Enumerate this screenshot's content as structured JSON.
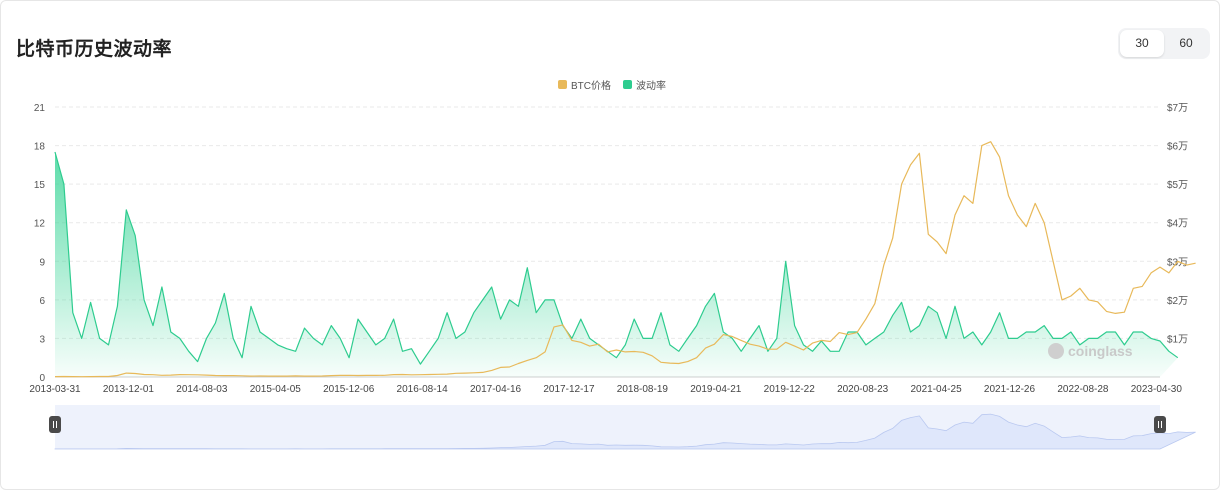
{
  "page": {
    "title": "比特币历史波动率",
    "toggle": {
      "options": [
        "30",
        "60"
      ],
      "selected": "30"
    },
    "watermark": "coinglass"
  },
  "colors": {
    "btc": "#e8b95a",
    "vol": "#2ecc8f",
    "vol_fill_top": "#3fd69a",
    "grid": "#e9e9e9",
    "navigator_fill": "#dfe7fb",
    "navigator_line": "#b9c8f0"
  },
  "chart_data": {
    "type": "line",
    "title": "",
    "legend": [
      "BTC价格",
      "波动率"
    ],
    "legend_position": "top-center",
    "x_tick_labels": [
      "2013-03-31",
      "2013-12-01",
      "2014-08-03",
      "2015-04-05",
      "2015-12-06",
      "2016-08-14",
      "2017-04-16",
      "2017-12-17",
      "2018-08-19",
      "2019-04-21",
      "2019-12-22",
      "2020-08-23",
      "2021-04-25",
      "2021-12-26",
      "2022-08-28",
      "2023-04-30"
    ],
    "y_left": {
      "ticks": [
        "0",
        "3",
        "6",
        "9",
        "12",
        "15",
        "18",
        "21"
      ],
      "range": [
        0,
        21
      ]
    },
    "y_right": {
      "ticks": [
        "$1万",
        "$2万",
        "$3万",
        "$4万",
        "$5万",
        "$6万",
        "$7万"
      ],
      "range": [
        0,
        70000
      ]
    },
    "x": [
      "2013-03-31",
      "2013-05-01",
      "2013-06-01",
      "2013-07-01",
      "2013-08-01",
      "2013-09-01",
      "2013-10-01",
      "2013-11-01",
      "2013-12-01",
      "2014-01-01",
      "2014-02-01",
      "2014-03-01",
      "2014-04-01",
      "2014-05-01",
      "2014-06-01",
      "2014-07-01",
      "2014-08-01",
      "2014-09-01",
      "2014-10-01",
      "2014-11-01",
      "2014-12-01",
      "2015-01-01",
      "2015-02-01",
      "2015-03-01",
      "2015-04-01",
      "2015-05-01",
      "2015-06-01",
      "2015-07-01",
      "2015-08-01",
      "2015-09-01",
      "2015-10-01",
      "2015-11-01",
      "2015-12-01",
      "2016-01-01",
      "2016-02-01",
      "2016-03-01",
      "2016-04-01",
      "2016-05-01",
      "2016-06-01",
      "2016-07-01",
      "2016-08-01",
      "2016-09-01",
      "2016-10-01",
      "2016-11-01",
      "2016-12-01",
      "2017-01-01",
      "2017-02-01",
      "2017-03-01",
      "2017-04-01",
      "2017-05-01",
      "2017-06-01",
      "2017-07-01",
      "2017-08-01",
      "2017-09-01",
      "2017-10-01",
      "2017-11-01",
      "2017-12-01",
      "2018-01-01",
      "2018-02-01",
      "2018-03-01",
      "2018-04-01",
      "2018-05-01",
      "2018-06-01",
      "2018-07-01",
      "2018-08-01",
      "2018-09-01",
      "2018-10-01",
      "2018-11-01",
      "2018-12-01",
      "2019-01-01",
      "2019-02-01",
      "2019-03-01",
      "2019-04-01",
      "2019-05-01",
      "2019-06-01",
      "2019-07-01",
      "2019-08-01",
      "2019-09-01",
      "2019-10-01",
      "2019-11-01",
      "2019-12-01",
      "2020-01-01",
      "2020-02-01",
      "2020-03-01",
      "2020-04-01",
      "2020-05-01",
      "2020-06-01",
      "2020-07-01",
      "2020-08-01",
      "2020-09-01",
      "2020-10-01",
      "2020-11-01",
      "2020-12-01",
      "2021-01-01",
      "2021-02-01",
      "2021-03-01",
      "2021-04-01",
      "2021-05-01",
      "2021-06-01",
      "2021-07-01",
      "2021-08-01",
      "2021-09-01",
      "2021-10-01",
      "2021-11-01",
      "2021-12-01",
      "2022-01-01",
      "2022-02-01",
      "2022-03-01",
      "2022-04-01",
      "2022-05-01",
      "2022-06-01",
      "2022-07-01",
      "2022-08-01",
      "2022-09-01",
      "2022-10-01",
      "2022-11-01",
      "2022-12-01",
      "2023-01-01",
      "2023-02-01",
      "2023-03-01",
      "2023-04-01",
      "2023-05-01",
      "2023-06-01",
      "2023-07-01",
      "2023-08-01"
    ],
    "series": [
      {
        "name": "BTC价格",
        "axis": "right",
        "values": [
          100,
          120,
          110,
          90,
          100,
          130,
          140,
          400,
          1000,
          900,
          650,
          600,
          450,
          500,
          620,
          600,
          580,
          480,
          380,
          370,
          360,
          300,
          240,
          260,
          240,
          235,
          240,
          280,
          240,
          235,
          260,
          350,
          420,
          430,
          380,
          415,
          420,
          450,
          620,
          660,
          575,
          605,
          640,
          700,
          750,
          950,
          1000,
          1100,
          1200,
          1700,
          2500,
          2600,
          3500,
          4300,
          5000,
          6500,
          13000,
          13500,
          9500,
          9000,
          8000,
          8500,
          6500,
          7000,
          6500,
          6600,
          6400,
          5500,
          3800,
          3600,
          3500,
          4000,
          5000,
          7500,
          8500,
          11000,
          10500,
          9500,
          8500,
          8000,
          7200,
          7200,
          9000,
          8000,
          7000,
          8800,
          9500,
          9200,
          11500,
          11000,
          11500,
          15000,
          19000,
          29000,
          36000,
          50000,
          55000,
          58000,
          37000,
          35000,
          32000,
          42000,
          47000,
          45000,
          60000,
          61000,
          57000,
          47000,
          42000,
          39000,
          45000,
          40000,
          30000,
          20000,
          21000,
          23000,
          20000,
          19500,
          17000,
          16500,
          16800,
          23000,
          23500,
          27000,
          28500,
          27000,
          30000,
          29000,
          29500
        ]
      },
      {
        "name": "波动率",
        "axis": "left",
        "values": [
          17.5,
          15,
          5,
          3,
          5.8,
          3,
          2.5,
          5.5,
          13,
          11,
          6,
          4,
          7,
          3.5,
          3,
          2,
          1.2,
          3,
          4.2,
          6.5,
          3,
          1.5,
          5.5,
          3.5,
          3,
          2.5,
          2.2,
          2,
          3.8,
          3,
          2.5,
          4,
          3,
          1.5,
          4.5,
          3.5,
          2.5,
          3,
          4.5,
          2,
          2.2,
          1,
          2,
          3,
          5,
          3,
          3.5,
          5,
          6,
          7,
          4.5,
          6,
          5.5,
          8.5,
          5,
          6,
          6,
          4,
          3,
          4.5,
          3,
          2.5,
          2,
          1.5,
          2.5,
          4.5,
          3,
          3,
          5,
          2.5,
          2,
          3,
          4,
          5.5,
          6.5,
          3.5,
          3,
          2,
          3,
          4,
          2,
          3,
          9,
          4,
          2.5,
          2,
          2.8,
          2,
          2,
          3.5,
          3.5,
          2.5,
          3,
          3.5,
          4.8,
          5.8,
          3.5,
          4,
          5.5,
          5,
          3,
          5.5,
          3,
          3.5,
          2.5,
          3.5,
          5,
          3,
          3,
          3.5,
          3.5,
          4,
          3,
          3,
          3.5,
          2.5,
          3,
          3,
          3.5,
          3.5,
          2.5,
          3.5,
          3.5,
          3,
          2.8,
          2,
          1.5
        ]
      }
    ]
  }
}
